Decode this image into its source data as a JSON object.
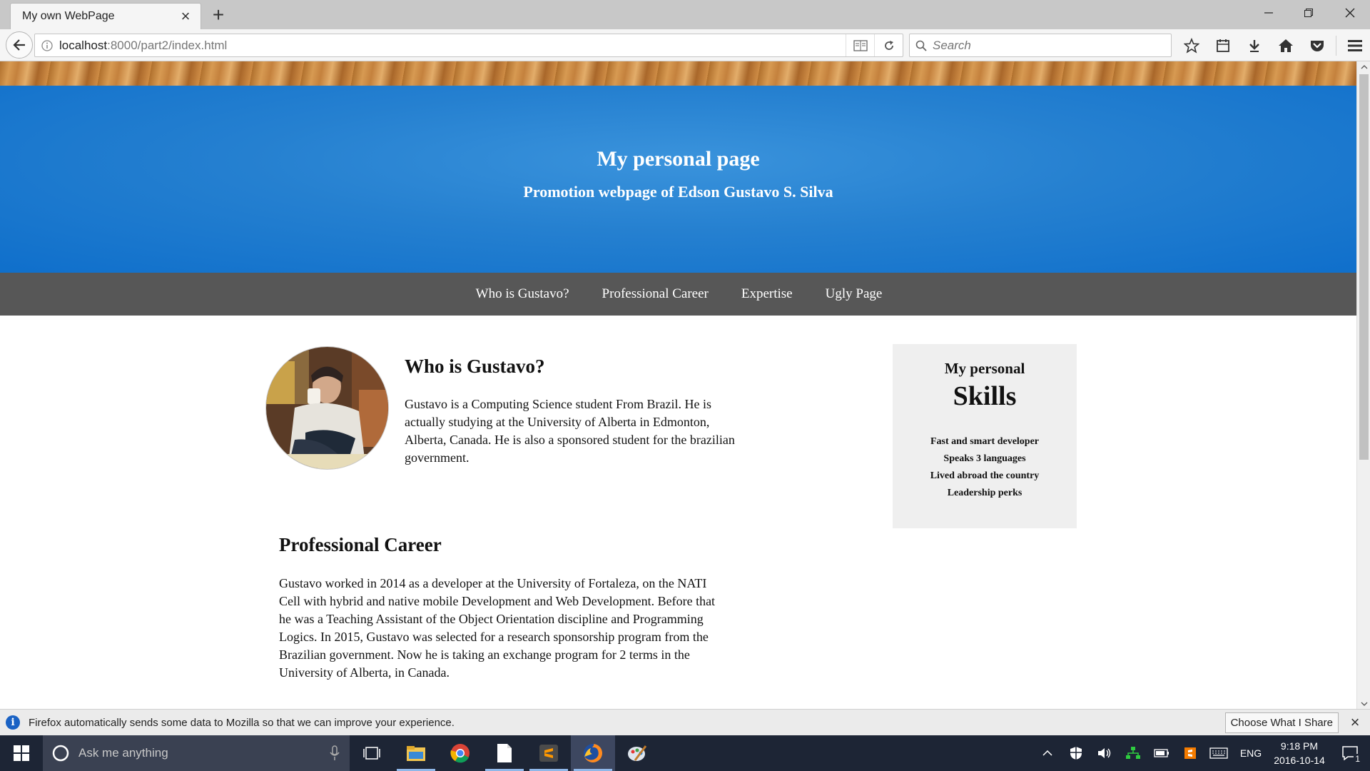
{
  "browser": {
    "tab_title": "My own WebPage",
    "url_host": "localhost",
    "url_rest": ":8000/part2/index.html",
    "search_placeholder": "Search"
  },
  "page": {
    "hero_title": "My personal page",
    "hero_subtitle": "Promotion webpage of Edson Gustavo S. Silva",
    "nav": [
      "Who is Gustavo?",
      "Professional Career",
      "Expertise",
      "Ugly Page"
    ],
    "about": {
      "title": "Who is Gustavo?",
      "lines": [
        "Gustavo is a Computing Science student From Brazil. He is",
        "actually studying at the University of Alberta in Edmonton,",
        "Alberta, Canada. He is also a sponsored student for the brazilian",
        "government."
      ]
    },
    "career": {
      "title": "Professional Career",
      "lines": [
        "Gustavo worked in 2014 as a developer at the University of Fortaleza, on the NATI",
        "Cell with hybrid and native mobile Development and Web Development. Before that",
        "he was a Teaching Assistant of the Object Orientation discipline and Programming",
        "Logics. In 2015, Gustavo was selected for a research sponsorship program from the",
        "Brazilian government. Now he is taking an exchange program for 2 terms in the",
        "University of Alberta, in Canada."
      ]
    },
    "skills": {
      "pre": "My personal",
      "title": "Skills",
      "items": [
        "Fast and smart developer",
        "Speaks 3 languages",
        "Lived abroad the country",
        "Leadership perks"
      ]
    }
  },
  "notification": {
    "text": "Firefox automatically sends some data to Mozilla so that we can improve your experience.",
    "button": "Choose What I Share"
  },
  "taskbar": {
    "search_placeholder": "Ask me anything",
    "lang": "ENG",
    "time": "9:18 PM",
    "date": "2016-10-14",
    "notif_count": "1"
  },
  "colors": {
    "hero_blue": "#1c7bd0",
    "nav_gray": "#575757",
    "skills_bg": "#efefef",
    "taskbar": "#1d2535"
  }
}
